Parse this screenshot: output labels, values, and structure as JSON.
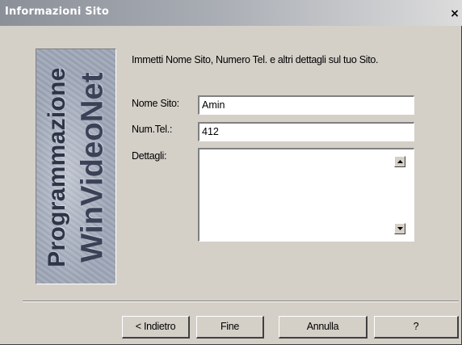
{
  "window": {
    "title": "Informazioni Sito",
    "close_label": "×"
  },
  "banner": {
    "line1": "Programmazione",
    "line2": "WinVideoNet"
  },
  "form": {
    "instruction": "Immetti Nome Sito, Numero Tel. e altri dettagli sul tuo Sito.",
    "site_name": {
      "label": "Nome Sito:",
      "value": "Amin"
    },
    "phone": {
      "label": "Num.Tel.:",
      "value": "412"
    },
    "details": {
      "label": "Dettagli:",
      "value": ""
    }
  },
  "buttons": {
    "back": "< Indietro",
    "finish": "Fine",
    "cancel": "Annulla",
    "help": "?"
  },
  "icons": {
    "scroll_up": "scroll-up-arrow-icon",
    "scroll_down": "scroll-down-arrow-icon",
    "close": "close-icon"
  },
  "colors": {
    "dialog_bg": "#d4d0c8",
    "banner_text": "#2e3547"
  }
}
